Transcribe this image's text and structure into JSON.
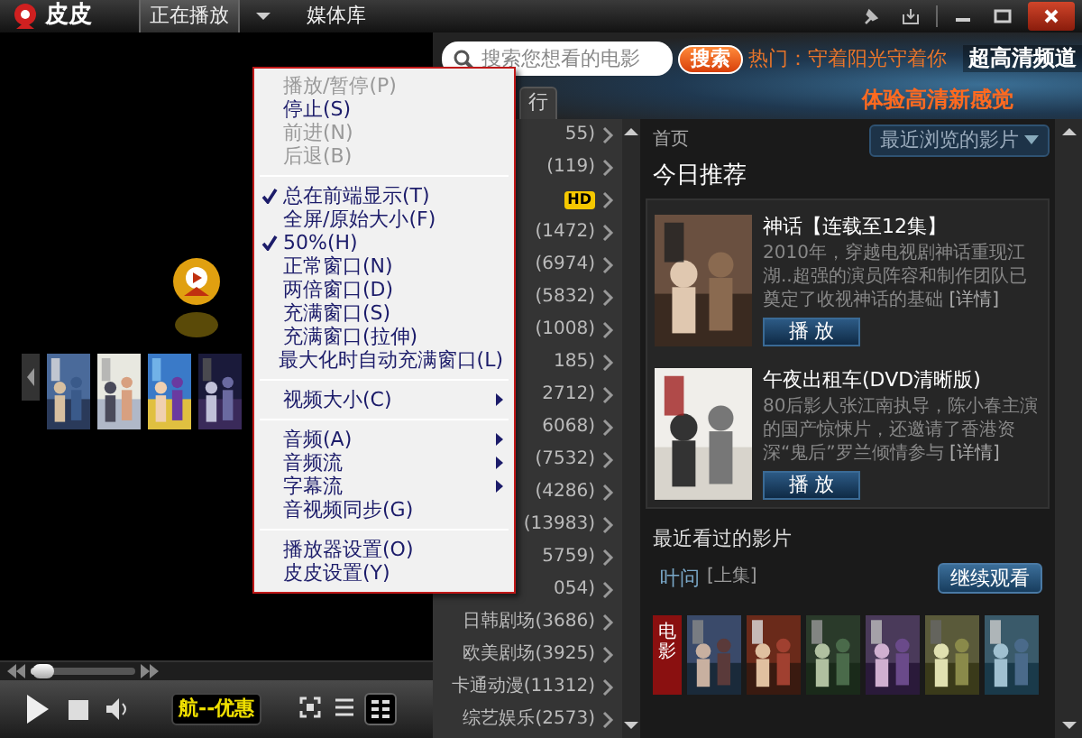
{
  "window": {
    "app_name": "皮皮",
    "tabs": [
      {
        "label": "正在播放",
        "selected": true
      },
      {
        "label": "媒体库",
        "selected": false
      }
    ]
  },
  "search": {
    "placeholder": "搜索您想看的电影",
    "button": "搜索",
    "hot": "热门：守着阳光守着你"
  },
  "banner": {
    "title": "超高清频道",
    "slogan": "体验高清新感觉"
  },
  "category_tab": {
    "label": "行"
  },
  "categories": [
    {
      "kind": "count",
      "text": "55)"
    },
    {
      "kind": "count",
      "text": "(119)"
    },
    {
      "kind": "badge",
      "text": "HD"
    },
    {
      "kind": "count",
      "text": "(1472)"
    },
    {
      "kind": "count",
      "text": "(6974)"
    },
    {
      "kind": "count",
      "text": "(5832)"
    },
    {
      "kind": "count",
      "text": "(1008)"
    },
    {
      "kind": "count",
      "text": "185)"
    },
    {
      "kind": "count",
      "text": "2712)"
    },
    {
      "kind": "count",
      "text": "6068)"
    },
    {
      "kind": "count",
      "text": "(7532)"
    },
    {
      "kind": "count",
      "text": "(4286)"
    },
    {
      "kind": "count",
      "text": "(13983)"
    },
    {
      "kind": "count",
      "text": "5759)"
    },
    {
      "kind": "count",
      "text": "054)"
    },
    {
      "kind": "count",
      "text": "日韩剧场(3686)"
    },
    {
      "kind": "count",
      "text": "欧美剧场(3925)"
    },
    {
      "kind": "count",
      "text": "卡通动漫(11312)"
    },
    {
      "kind": "count",
      "text": "综艺娱乐(2573)"
    }
  ],
  "content": {
    "breadcrumb": "首页",
    "recent_button": "最近浏览的影片",
    "heading": "今日推荐",
    "recommendations": [
      {
        "title": "神话【连载至12集】",
        "description": "2010年，穿越电视剧神话重现江湖..超强的演员阵容和制作团队已奠定了收视神话的基础",
        "details": "[详情]",
        "play": "播 放",
        "kind": "picture"
      },
      {
        "title": "午夜出租车(DVD清晰版)",
        "description": "80后影人张江南执导，陈小春主演的国产惊悚片，还邀请了香港资深“鬼后”罗兰倾情参与",
        "details": "[详情]",
        "play": "播 放",
        "kind": "picture"
      }
    ],
    "recent": {
      "heading": "最近看过的影片",
      "title": "叶问",
      "episode": "[上集]",
      "resume": "继续观看"
    },
    "bottom_tab": "电影"
  },
  "player": {
    "seek": {
      "level": 0.12
    },
    "ticker": "航--优惠",
    "view_modes": [
      {
        "kind": "fullscreen",
        "selected": false
      },
      {
        "kind": "list",
        "selected": false
      },
      {
        "kind": "grid",
        "selected": true
      }
    ]
  },
  "context_menu": {
    "groups": [
      [
        {
          "label": "播放/暂停(P)",
          "disabled": true,
          "checked": false,
          "submenu": false
        },
        {
          "label": "停止(S)",
          "disabled": false,
          "checked": false,
          "submenu": false
        },
        {
          "label": "前进(N)",
          "disabled": true,
          "checked": false,
          "submenu": false
        },
        {
          "label": "后退(B)",
          "disabled": true,
          "checked": false,
          "submenu": false
        }
      ],
      [
        {
          "label": "总在前端显示(T)",
          "disabled": false,
          "checked": true,
          "submenu": false
        },
        {
          "label": "全屏/原始大小(F)",
          "disabled": false,
          "checked": false,
          "submenu": false
        },
        {
          "label": "50%(H)",
          "disabled": false,
          "checked": true,
          "submenu": false
        },
        {
          "label": "正常窗口(N)",
          "disabled": false,
          "checked": false,
          "submenu": false
        },
        {
          "label": "两倍窗口(D)",
          "disabled": false,
          "checked": false,
          "submenu": false
        },
        {
          "label": "充满窗口(S)",
          "disabled": false,
          "checked": false,
          "submenu": false
        },
        {
          "label": "充满窗口(拉伸)",
          "disabled": false,
          "checked": false,
          "submenu": false
        },
        {
          "label": "最大化时自动充满窗口(L)",
          "disabled": false,
          "checked": false,
          "submenu": false
        }
      ],
      [
        {
          "label": "视频大小(C)",
          "disabled": false,
          "checked": false,
          "submenu": true
        }
      ],
      [
        {
          "label": "音频(A)",
          "disabled": false,
          "checked": false,
          "submenu": true
        },
        {
          "label": "音频流",
          "disabled": false,
          "checked": false,
          "submenu": true
        },
        {
          "label": "字幕流",
          "disabled": false,
          "checked": false,
          "submenu": true
        },
        {
          "label": "音视频同步(G)",
          "disabled": false,
          "checked": false,
          "submenu": false
        }
      ],
      [
        {
          "label": "播放器设置(O)",
          "disabled": false,
          "checked": false,
          "submenu": false
        },
        {
          "label": "皮皮设置(Y)",
          "disabled": false,
          "checked": false,
          "submenu": false
        }
      ]
    ]
  }
}
